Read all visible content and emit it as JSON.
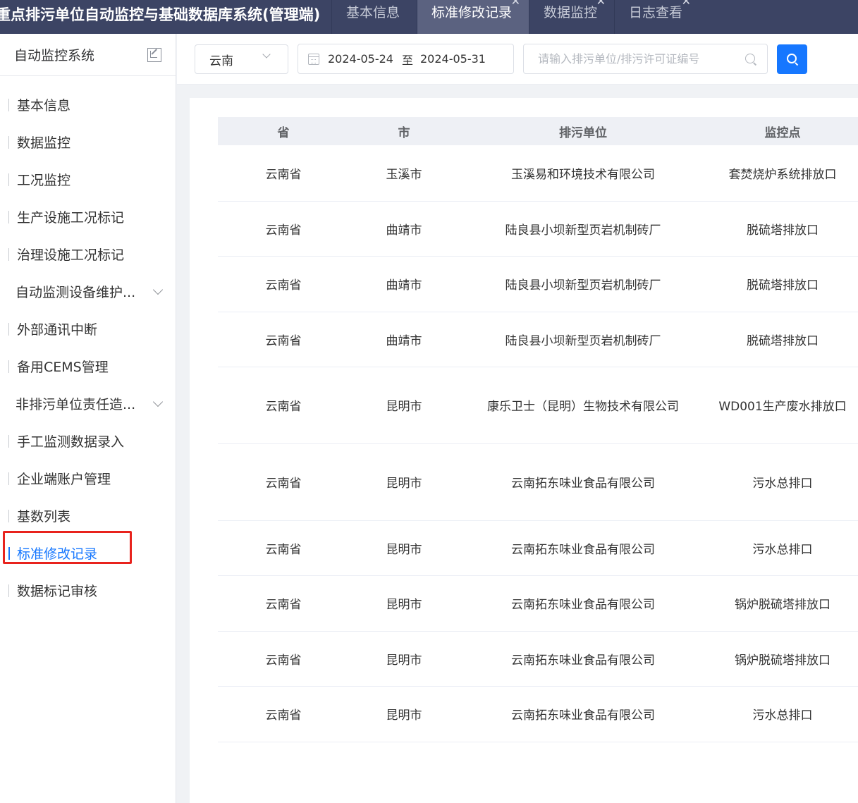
{
  "app": {
    "title": "重点排污单位自动监控与基础数据库系统(管理端)",
    "tabs": [
      {
        "label": "基本信息",
        "active": false,
        "closable": false
      },
      {
        "label": "标准修改记录",
        "active": true,
        "closable": true
      },
      {
        "label": "数据监控",
        "active": false,
        "closable": true
      },
      {
        "label": "日志查看",
        "active": false,
        "closable": true
      }
    ]
  },
  "sidebar": {
    "title": "自动监控系统",
    "items": [
      {
        "label": "基本信息"
      },
      {
        "label": "数据监控"
      },
      {
        "label": "工况监控"
      },
      {
        "label": "生产设施工况标记"
      },
      {
        "label": "治理设施工况标记"
      },
      {
        "label": "自动监测设备维护..."
      },
      {
        "label": "外部通讯中断"
      },
      {
        "label": "备用CEMS管理"
      },
      {
        "label": "非排污单位责任造..."
      },
      {
        "label": "手工监测数据录入"
      },
      {
        "label": "企业端账户管理"
      },
      {
        "label": "基数列表"
      },
      {
        "label": "标准修改记录"
      },
      {
        "label": "数据标记审核"
      }
    ],
    "active_index": 12
  },
  "filters": {
    "region": "云南",
    "date_start": "2024-05-24",
    "date_separator": "至",
    "date_end": "2024-05-31",
    "search_placeholder": "请输入排污单位/排污许可证编号"
  },
  "table": {
    "columns": [
      "省",
      "市",
      "排污单位",
      "监控点"
    ],
    "rows": [
      [
        "云南省",
        "玉溪市",
        "玉溪易和环境技术有限公司",
        "套焚烧炉系统排放口"
      ],
      [
        "云南省",
        "曲靖市",
        "陆良县小坝新型页岩机制砖厂",
        "脱硫塔排放口"
      ],
      [
        "云南省",
        "曲靖市",
        "陆良县小坝新型页岩机制砖厂",
        "脱硫塔排放口"
      ],
      [
        "云南省",
        "曲靖市",
        "陆良县小坝新型页岩机制砖厂",
        "脱硫塔排放口"
      ],
      [
        "云南省",
        "昆明市",
        "康乐卫士（昆明）生物技术有限公司",
        "WD001生产废水排放口"
      ],
      [
        "云南省",
        "昆明市",
        "云南拓东味业食品有限公司",
        "污水总排口"
      ],
      [
        "云南省",
        "昆明市",
        "云南拓东味业食品有限公司",
        "污水总排口"
      ],
      [
        "云南省",
        "昆明市",
        "云南拓东味业食品有限公司",
        "锅炉脱硫塔排放口"
      ],
      [
        "云南省",
        "昆明市",
        "云南拓东味业食品有限公司",
        "锅炉脱硫塔排放口"
      ],
      [
        "云南省",
        "昆明市",
        "云南拓东味业食品有限公司",
        "污水总排口"
      ]
    ]
  },
  "colors": {
    "topbar": "#3c4464",
    "accent": "#1677ff",
    "highlight": "#e8231d"
  }
}
